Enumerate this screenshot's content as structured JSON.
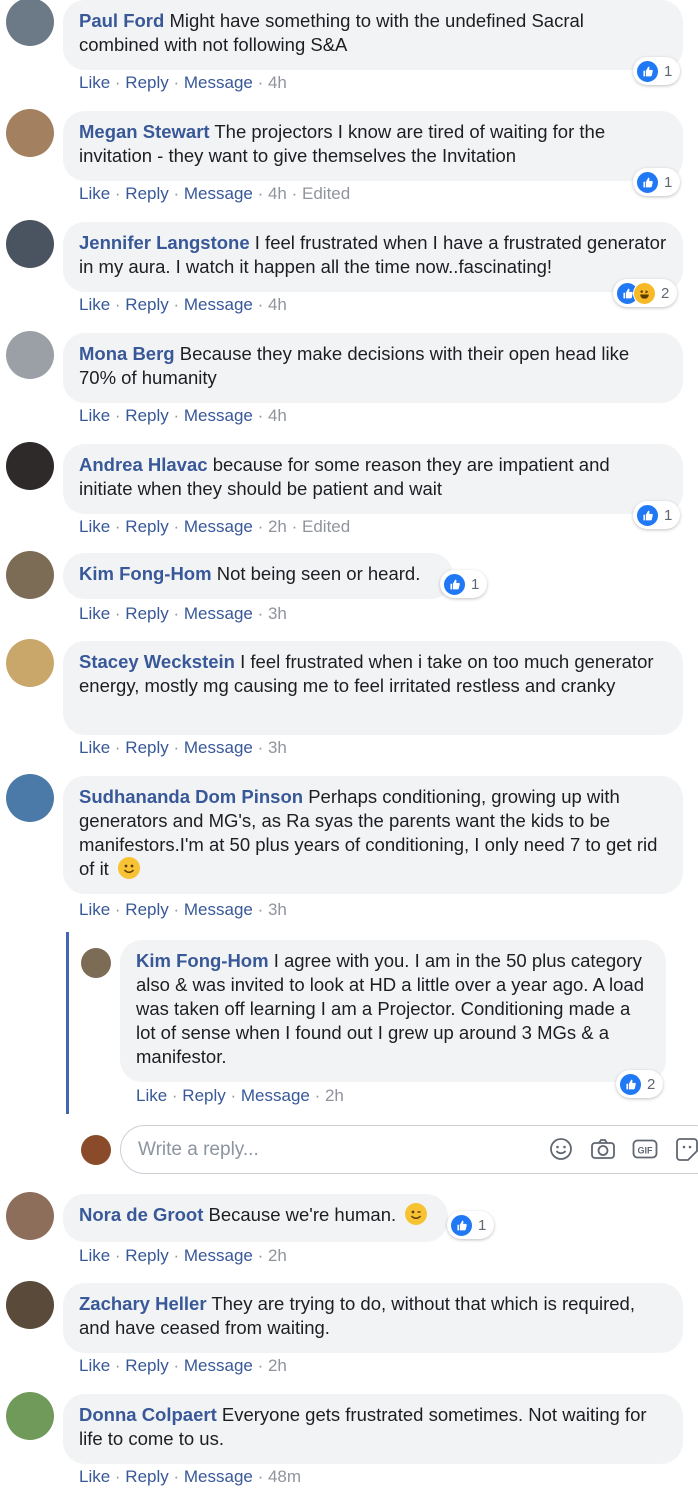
{
  "actions": {
    "like": "Like",
    "reply": "Reply",
    "message": "Message",
    "sep": " · ",
    "edited": "Edited"
  },
  "comments": [
    {
      "name": "Paul Ford",
      "text": "Might have something to with the undefined Sacral combined with not following S&A",
      "time": "4h",
      "edited": false,
      "reactions": "1"
    },
    {
      "name": "Megan Stewart",
      "text": "The projectors I know are tired of waiting for the invitation - they want to give themselves the Invitation",
      "time": "4h",
      "edited": true,
      "reactions": "1"
    },
    {
      "name": "Jennifer Langstone",
      "text": "I feel frustrated when I have a frustrated generator in my aura. I watch it happen all the time now..fascinating!",
      "time": "4h",
      "edited": false,
      "reactions": "2"
    },
    {
      "name": "Mona Berg",
      "text": "Because they make decisions with their open head like 70% of humanity",
      "time": "4h",
      "edited": false,
      "reactions": ""
    },
    {
      "name": "Andrea Hlavac",
      "text": "because for some reason they are impatient and initiate when they should be patient and wait",
      "time": "2h",
      "edited": true,
      "reactions": "1"
    },
    {
      "name": "Kim Fong-Hom",
      "text": "Not being seen or heard.",
      "time": "3h",
      "edited": false,
      "reactions": "1"
    },
    {
      "name": "Stacey Weckstein",
      "text": "I feel frustrated when i take on too much generator energy, mostly mg causing me to feel irritated restless and cranky",
      "time": "3h",
      "edited": false,
      "reactions": ""
    },
    {
      "name": "Sudhananda Dom Pinson",
      "text": "Perhaps conditioning, growing up with generators and MG's, as Ra syas the parents want the kids to be manifestors.I'm at 50 plus years of conditioning, I only need 7 to get rid of it",
      "time": "3h",
      "edited": false,
      "reactions": ""
    },
    {
      "name": "Kim Fong-Hom",
      "text": "I agree with you. I am in the 50 plus category also & was invited to look at HD a little over a year ago. A load was taken off learning I am a Projector. Conditioning made a lot of sense when I found out I grew up around 3 MGs & a manifestor.",
      "time": "2h",
      "edited": false,
      "reactions": "2"
    },
    {
      "name": "Nora de Groot",
      "text": "Because we're human.",
      "time": "2h",
      "edited": false,
      "reactions": "1"
    },
    {
      "name": "Zachary Heller",
      "text": "They are trying to do, without that which is required, and have ceased from waiting.",
      "time": "2h",
      "edited": false,
      "reactions": ""
    },
    {
      "name": "Donna Colpaert",
      "text": "Everyone gets frustrated sometimes. Not waiting for life to come to us.",
      "time": "48m",
      "edited": false,
      "reactions": ""
    }
  ],
  "reply_box": {
    "placeholder": "Write a reply..."
  },
  "colors": {
    "link": "#385898",
    "meta": "#90949c",
    "bubble": "#f2f3f5",
    "like": "#2078f4",
    "thread": "#4267b2"
  }
}
